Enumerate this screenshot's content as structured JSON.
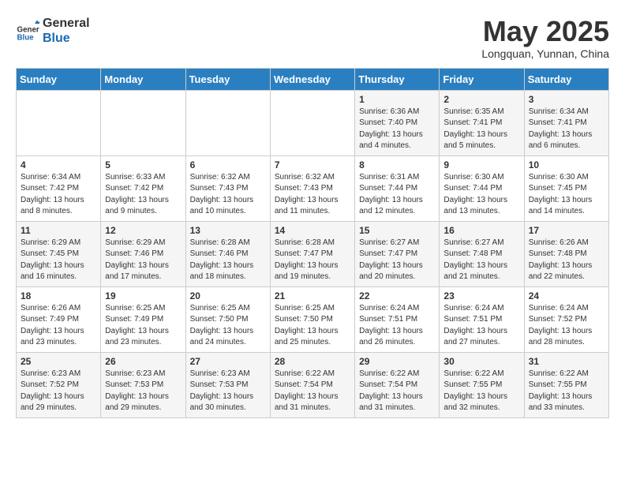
{
  "logo": {
    "general": "General",
    "blue": "Blue"
  },
  "title": "May 2025",
  "location": "Longquan, Yunnan, China",
  "days_of_week": [
    "Sunday",
    "Monday",
    "Tuesday",
    "Wednesday",
    "Thursday",
    "Friday",
    "Saturday"
  ],
  "weeks": [
    [
      {
        "day": "",
        "info": ""
      },
      {
        "day": "",
        "info": ""
      },
      {
        "day": "",
        "info": ""
      },
      {
        "day": "",
        "info": ""
      },
      {
        "day": "1",
        "info": "Sunrise: 6:36 AM\nSunset: 7:40 PM\nDaylight: 13 hours\nand 4 minutes."
      },
      {
        "day": "2",
        "info": "Sunrise: 6:35 AM\nSunset: 7:41 PM\nDaylight: 13 hours\nand 5 minutes."
      },
      {
        "day": "3",
        "info": "Sunrise: 6:34 AM\nSunset: 7:41 PM\nDaylight: 13 hours\nand 6 minutes."
      }
    ],
    [
      {
        "day": "4",
        "info": "Sunrise: 6:34 AM\nSunset: 7:42 PM\nDaylight: 13 hours\nand 8 minutes."
      },
      {
        "day": "5",
        "info": "Sunrise: 6:33 AM\nSunset: 7:42 PM\nDaylight: 13 hours\nand 9 minutes."
      },
      {
        "day": "6",
        "info": "Sunrise: 6:32 AM\nSunset: 7:43 PM\nDaylight: 13 hours\nand 10 minutes."
      },
      {
        "day": "7",
        "info": "Sunrise: 6:32 AM\nSunset: 7:43 PM\nDaylight: 13 hours\nand 11 minutes."
      },
      {
        "day": "8",
        "info": "Sunrise: 6:31 AM\nSunset: 7:44 PM\nDaylight: 13 hours\nand 12 minutes."
      },
      {
        "day": "9",
        "info": "Sunrise: 6:30 AM\nSunset: 7:44 PM\nDaylight: 13 hours\nand 13 minutes."
      },
      {
        "day": "10",
        "info": "Sunrise: 6:30 AM\nSunset: 7:45 PM\nDaylight: 13 hours\nand 14 minutes."
      }
    ],
    [
      {
        "day": "11",
        "info": "Sunrise: 6:29 AM\nSunset: 7:45 PM\nDaylight: 13 hours\nand 16 minutes."
      },
      {
        "day": "12",
        "info": "Sunrise: 6:29 AM\nSunset: 7:46 PM\nDaylight: 13 hours\nand 17 minutes."
      },
      {
        "day": "13",
        "info": "Sunrise: 6:28 AM\nSunset: 7:46 PM\nDaylight: 13 hours\nand 18 minutes."
      },
      {
        "day": "14",
        "info": "Sunrise: 6:28 AM\nSunset: 7:47 PM\nDaylight: 13 hours\nand 19 minutes."
      },
      {
        "day": "15",
        "info": "Sunrise: 6:27 AM\nSunset: 7:47 PM\nDaylight: 13 hours\nand 20 minutes."
      },
      {
        "day": "16",
        "info": "Sunrise: 6:27 AM\nSunset: 7:48 PM\nDaylight: 13 hours\nand 21 minutes."
      },
      {
        "day": "17",
        "info": "Sunrise: 6:26 AM\nSunset: 7:48 PM\nDaylight: 13 hours\nand 22 minutes."
      }
    ],
    [
      {
        "day": "18",
        "info": "Sunrise: 6:26 AM\nSunset: 7:49 PM\nDaylight: 13 hours\nand 23 minutes."
      },
      {
        "day": "19",
        "info": "Sunrise: 6:25 AM\nSunset: 7:49 PM\nDaylight: 13 hours\nand 23 minutes."
      },
      {
        "day": "20",
        "info": "Sunrise: 6:25 AM\nSunset: 7:50 PM\nDaylight: 13 hours\nand 24 minutes."
      },
      {
        "day": "21",
        "info": "Sunrise: 6:25 AM\nSunset: 7:50 PM\nDaylight: 13 hours\nand 25 minutes."
      },
      {
        "day": "22",
        "info": "Sunrise: 6:24 AM\nSunset: 7:51 PM\nDaylight: 13 hours\nand 26 minutes."
      },
      {
        "day": "23",
        "info": "Sunrise: 6:24 AM\nSunset: 7:51 PM\nDaylight: 13 hours\nand 27 minutes."
      },
      {
        "day": "24",
        "info": "Sunrise: 6:24 AM\nSunset: 7:52 PM\nDaylight: 13 hours\nand 28 minutes."
      }
    ],
    [
      {
        "day": "25",
        "info": "Sunrise: 6:23 AM\nSunset: 7:52 PM\nDaylight: 13 hours\nand 29 minutes."
      },
      {
        "day": "26",
        "info": "Sunrise: 6:23 AM\nSunset: 7:53 PM\nDaylight: 13 hours\nand 29 minutes."
      },
      {
        "day": "27",
        "info": "Sunrise: 6:23 AM\nSunset: 7:53 PM\nDaylight: 13 hours\nand 30 minutes."
      },
      {
        "day": "28",
        "info": "Sunrise: 6:22 AM\nSunset: 7:54 PM\nDaylight: 13 hours\nand 31 minutes."
      },
      {
        "day": "29",
        "info": "Sunrise: 6:22 AM\nSunset: 7:54 PM\nDaylight: 13 hours\nand 31 minutes."
      },
      {
        "day": "30",
        "info": "Sunrise: 6:22 AM\nSunset: 7:55 PM\nDaylight: 13 hours\nand 32 minutes."
      },
      {
        "day": "31",
        "info": "Sunrise: 6:22 AM\nSunset: 7:55 PM\nDaylight: 13 hours\nand 33 minutes."
      }
    ]
  ]
}
